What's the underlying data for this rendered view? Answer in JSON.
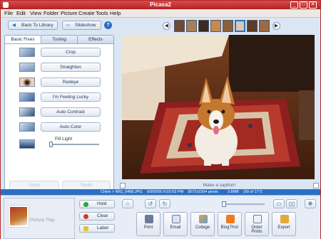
{
  "window": {
    "title": "Picasa2"
  },
  "menu": [
    "File",
    "Edit",
    "View",
    "Folder",
    "Picture",
    "Create",
    "Tools",
    "Help"
  ],
  "top_buttons": {
    "back": "Back To Library",
    "slideshow": "Slideshow",
    "help": "?"
  },
  "tabs": [
    "Basic Fixes",
    "Tuning",
    "Effects"
  ],
  "fixes": [
    "Crop",
    "Straighten",
    "Redeye",
    "I'm Feeling Lucky",
    "Auto Contrast",
    "Auto Color"
  ],
  "fill_light": {
    "label": "Fill Light",
    "value": 0
  },
  "undo_redo": {
    "undo": "Undo",
    "redo": "Redo"
  },
  "caption": {
    "placeholder": "Make a caption!"
  },
  "info": {
    "path": "Chine > IMG_0468.JPG",
    "datetime": "6/9/2006 6:03:03 PM",
    "dimensions": "3072x2304 pixels",
    "size": "3.8MB",
    "position": "(99 of 177)"
  },
  "tray": {
    "label": "Picture Tray",
    "hold": "Hold",
    "clear": "Clear",
    "label_btn": "Label"
  },
  "actions": [
    "Print",
    "Email",
    "Collage",
    "BlogThis!",
    "Order Prints",
    "Export"
  ],
  "colors": {
    "title_bar": "#b52222",
    "info_bar": "#2a6fc2",
    "pane": "#dbe6f4"
  },
  "window_controls": {
    "minimize": "_",
    "maximize": "□",
    "close": "✕"
  },
  "nav": {
    "prev": "◀",
    "next": "▶"
  }
}
